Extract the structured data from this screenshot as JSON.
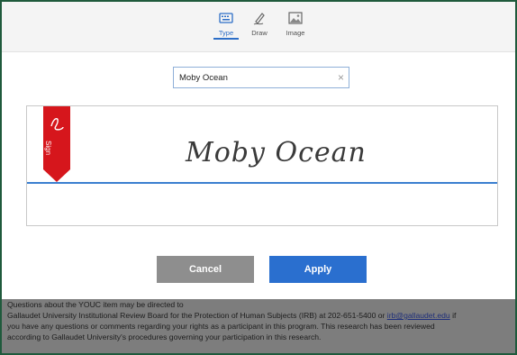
{
  "tabs": [
    {
      "label": "Type",
      "icon": "keyboard-icon",
      "active": true
    },
    {
      "label": "Draw",
      "icon": "pen-icon",
      "active": false
    },
    {
      "label": "Image",
      "icon": "image-icon",
      "active": false
    }
  ],
  "name_input": {
    "value": "Moby Ocean",
    "clear_icon": "×"
  },
  "signature": {
    "text": "Moby Ocean",
    "ribbon_label": "Sign"
  },
  "buttons": {
    "cancel": "Cancel",
    "apply": "Apply"
  },
  "colors": {
    "accent": "#2a6fcf",
    "ribbon": "#d6161c",
    "cancel": "#8e8e8e"
  },
  "background_text": {
    "line1": "Questions about the YOUC item may be directed to",
    "line2_before": "Gallaudet University Institutional Review Board for the Protection of Human Subjects (IRB) at 202-651-5400 or",
    "line2_link": "irb@gallaudet.edu",
    "line2_after": "if",
    "line3": "you have any questions or comments regarding your rights as a participant in this program.  This research has been reviewed",
    "line4": "according to Gallaudet University's procedures governing your participation in this research."
  }
}
